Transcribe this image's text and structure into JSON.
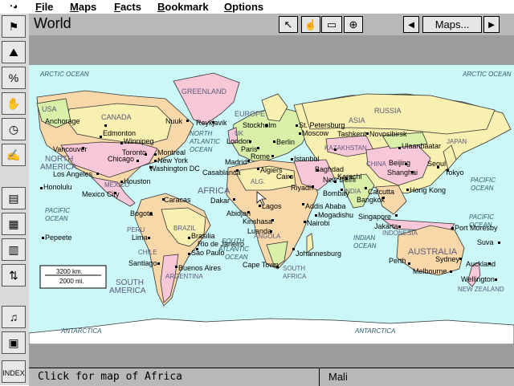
{
  "menu": [
    "File",
    "Maps",
    "Facts",
    "Bookmark",
    "Options"
  ],
  "window": {
    "title": "World",
    "maps_button": "Maps...",
    "left_arrow": "◄",
    "right_arrow": "►"
  },
  "status": {
    "hint": "Click for map of Africa",
    "location": "Mali"
  },
  "scale": {
    "km": "3200 km.",
    "mi": "2000 mi."
  },
  "oceans": [
    "ARCTIC OCEAN",
    "ARCTIC OCEAN",
    "NORTH",
    "ATLANTIC",
    "OCEAN",
    "SOUTH",
    "ATLANTIC",
    "OCEAN",
    "PACIFIC",
    "OCEAN",
    "PACIFIC",
    "OCEAN",
    "PACIFIC",
    "OCEAN",
    "INDIAN",
    "OCEAN",
    "ANTARCTICA",
    "ANTARCTICA"
  ],
  "regions": [
    "GREENLAND",
    "EUROPE",
    "ASIA",
    "RUSSIA",
    "CANADA",
    "NORTH",
    "AMERICA",
    "USA",
    "AFRICA",
    "SOUTH",
    "AMERICA",
    "AUSTRALIA",
    "NEW ZEALAND",
    "MEXICO",
    "BRAZIL",
    "PERU",
    "CHILE",
    "ARGENTINA",
    "INDONESIA",
    "CHINA",
    "KAZAKHSTAN",
    "UK",
    "SOUTH",
    "AFRICA",
    "ANGOLA",
    "JAPAN",
    "INDIA",
    "ALG."
  ],
  "cities": [
    "Anchorage",
    "Edmonton",
    "Winnipeg",
    "Vancouver",
    "Toronto",
    "Montreal",
    "Chicago",
    "New York",
    "Washington DC",
    "Los Angeles",
    "Houston",
    "Honolulu",
    "Mexico City",
    "Caracas",
    "Bogota",
    "Lima",
    "Brasilia",
    "Rio de Janeiro",
    "Sao Paulo",
    "Santiago",
    "Buenos Aires",
    "Pepeete",
    "Nuuk",
    "Reykjavik",
    "Stockholm",
    "St. Petersburg",
    "Moscow",
    "London",
    "Berlin",
    "Paris",
    "Madrid",
    "Rome",
    "Casablanca",
    "Algiers",
    "Istanbul",
    "Cairo",
    "Baghdad",
    "Riyadh",
    "Dakar",
    "Abidjan",
    "Lagos",
    "Kinshasa",
    "Addis Ababa",
    "Nairobi",
    "Mogadishu",
    "Luanda",
    "Johannesburg",
    "Cape Town",
    "Tashkent",
    "Novosibirsk",
    "Ulaanbaatar",
    "Beijing",
    "Shanghai",
    "Seoul",
    "Tokyo",
    "New Delhi",
    "Karachi",
    "Bombay",
    "Calcutta",
    "Bangkok",
    "Hong Kong",
    "Singapore",
    "Jakarta",
    "Port Moresby",
    "Perth",
    "Sydney",
    "Melbourne",
    "Auckland",
    "Wellington",
    "Suva"
  ]
}
